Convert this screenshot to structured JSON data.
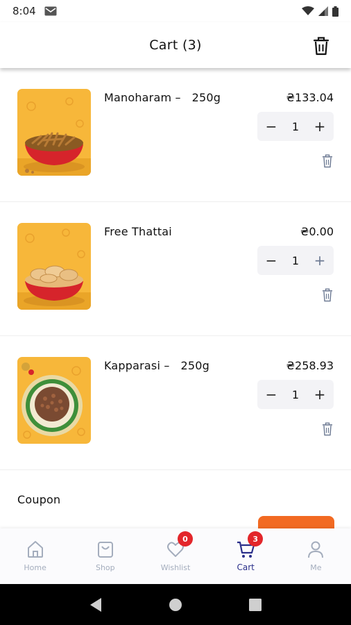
{
  "status_bar": {
    "time": "8:04"
  },
  "header": {
    "title": "Cart (3)"
  },
  "cart_items": [
    {
      "name": "Manoharam –   250g",
      "price": "₴133.04",
      "quantity": "1"
    },
    {
      "name": "Free Thattai",
      "price": "₴0.00",
      "quantity": "1"
    },
    {
      "name": "Kapparasi –   250g",
      "price": "₴258.93",
      "quantity": "1"
    }
  ],
  "coupon": {
    "label": "Coupon"
  },
  "bottom_nav": {
    "items": [
      {
        "label": "Home"
      },
      {
        "label": "Shop"
      },
      {
        "label": "Wishlist",
        "badge": "0"
      },
      {
        "label": "Cart",
        "badge": "3",
        "active": true
      },
      {
        "label": "Me"
      }
    ]
  },
  "colors": {
    "accent": "#2a2f8a",
    "badge": "#e3262b",
    "apply_button": "#f26a22",
    "stepper_bg": "#f3f3f6",
    "inactive_nav": "#a4adbd"
  }
}
